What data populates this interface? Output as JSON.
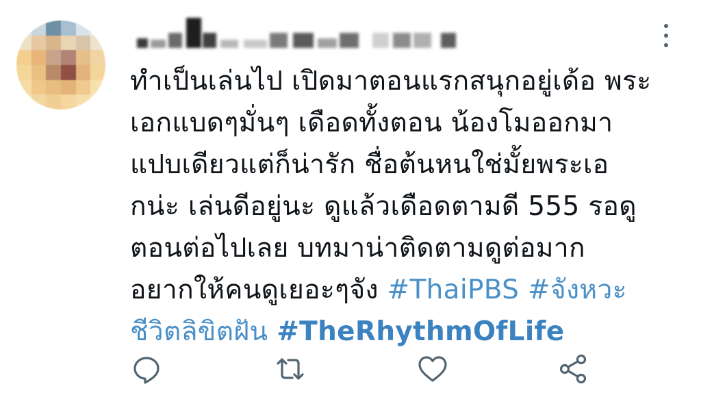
{
  "tweet": {
    "text_lines": [
      "ทำเป็นเล่นไป เปิดมาตอนแรกสนุกอยู่เด้อ พระ",
      "เอกแบดๆมั่นๆ เดือดทั้งตอน น้องโมออกมา",
      "แปบเดียวแต่ก็น่ารัก ชื่อต้นหนใช่มั้ยพระเอ",
      "กน่ะ เล่นดีอยู่นะ ดูแล้วเดือดตามดี 555 รอดู",
      "ตอนต่อไปเลย บทมาน่าติดตามดูต่อมาก"
    ],
    "line6_text": "อยากให้คนดูเยอะๆจัง ",
    "hashtag_thaipbs": "#ThaiPBS",
    "hashtag_thai_part1": "#จังหวะ",
    "hashtag_thai_part2": "ชีวิตลิขิตฝัน",
    "hashtag_rhythm": "#TheRhythmOfLife"
  },
  "icons": {
    "more": "vertical-ellipsis-icon",
    "reply": "reply-icon",
    "retweet": "retweet-icon",
    "like": "heart-icon",
    "share": "share-icon"
  },
  "colors": {
    "text": "#0f1419",
    "hashtag": "#4a90c7",
    "icon": "#536471"
  }
}
